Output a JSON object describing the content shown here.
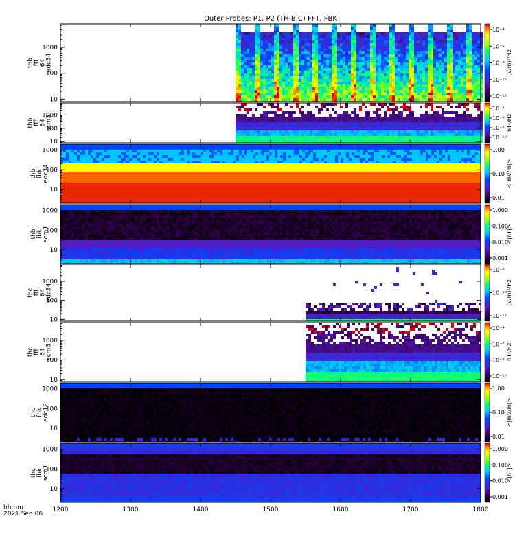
{
  "chart_data": {
    "type": "heatmap",
    "title": "Outer Probes: P1, P2 (TH-B,C) FFT, FBK",
    "footer": {
      "time_label": "hhmm",
      "date_label": "2021 Sep 06"
    },
    "x": {
      "min": 1200,
      "max": 1800,
      "ticks": [
        "1200",
        "1300",
        "1400",
        "1500",
        "1600",
        "1700",
        "1800"
      ]
    },
    "y_scale": "log",
    "panels": [
      {
        "label": [
          "thb",
          "fff",
          "64",
          "edc34"
        ],
        "ylim": [
          8,
          8000
        ],
        "y_ticks": [
          "10",
          "100",
          "1000"
        ],
        "kind": "fft_e",
        "data_start": 1450,
        "data_end": 1800,
        "colorbar": {
          "unit": "(V/m)²/Hz",
          "ticks": [
            "10⁻⁴",
            "10⁻⁶",
            "10⁻⁸",
            "10⁻¹⁰",
            "10⁻¹²"
          ]
        }
      },
      {
        "label": [
          "thb",
          "fff",
          "64",
          "scm3"
        ],
        "ylim": [
          8,
          8000
        ],
        "y_ticks": [
          "10",
          "100",
          "1000"
        ],
        "kind": "fft_b",
        "data_start": 1450,
        "data_end": 1800,
        "colorbar": {
          "unit": "nT²/Hz",
          "ticks": [
            "10⁻⁴",
            "10⁻⁶",
            "10⁻⁸",
            "10⁻¹⁰"
          ]
        }
      },
      {
        "label": [
          "thb",
          "fbk",
          "edc34"
        ],
        "ylim": [
          2,
          2000
        ],
        "y_ticks": [
          "10",
          "100",
          "1000"
        ],
        "kind": "fbk_e",
        "data_start": 1200,
        "data_end": 1800,
        "colorbar": {
          "unit": "<|mV/m|>",
          "ticks": [
            "1.00",
            "0.10",
            "0.01"
          ]
        }
      },
      {
        "label": [
          "thb",
          "fbk",
          "scm1"
        ],
        "ylim": [
          2,
          2000
        ],
        "y_ticks": [
          "10",
          "100",
          "1000"
        ],
        "kind": "fbk_b",
        "data_start": 1200,
        "data_end": 1800,
        "colorbar": {
          "unit": "<|nT|>",
          "ticks": [
            "1.000",
            "0.100",
            "0.010",
            "0.001"
          ]
        }
      },
      {
        "label": [
          "thc",
          "fff",
          "64",
          "edc34"
        ],
        "ylim": [
          8,
          8000
        ],
        "y_ticks": [
          "10",
          "100",
          "1000"
        ],
        "kind": "fft_e2",
        "data_start": 1550,
        "data_end": 1800,
        "colorbar": {
          "unit": "(V/m)²/Hz",
          "ticks": [
            "10⁻⁸",
            "10⁻¹⁰",
            "10⁻¹²"
          ]
        }
      },
      {
        "label": [
          "thc",
          "fff",
          "64",
          "scm3"
        ],
        "ylim": [
          8,
          8000
        ],
        "y_ticks": [
          "10",
          "100",
          "1000"
        ],
        "kind": "fft_b",
        "data_start": 1550,
        "data_end": 1800,
        "colorbar": {
          "unit": "nT²/Hz",
          "ticks": [
            "10⁻⁴",
            "10⁻⁶",
            "10⁻⁸",
            "10⁻¹⁰"
          ]
        }
      },
      {
        "label": [
          "thc",
          "fbk",
          "edc12"
        ],
        "ylim": [
          2,
          2000
        ],
        "y_ticks": [
          "10",
          "100",
          "1000"
        ],
        "kind": "fbk_e2",
        "data_start": 1200,
        "data_end": 1800,
        "colorbar": {
          "unit": "<|mV/m|>",
          "ticks": [
            "1.00",
            "0.10",
            "0.01"
          ]
        }
      },
      {
        "label": [
          "thc",
          "fbk",
          "scm1"
        ],
        "ylim": [
          2,
          2000
        ],
        "y_ticks": [
          "10",
          "100",
          "1000"
        ],
        "kind": "fbk_b2",
        "data_start": 1200,
        "data_end": 1800,
        "colorbar": {
          "unit": "<|nT|>",
          "ticks": [
            "1.000",
            "0.100",
            "0.010",
            "0.001"
          ]
        }
      }
    ]
  }
}
